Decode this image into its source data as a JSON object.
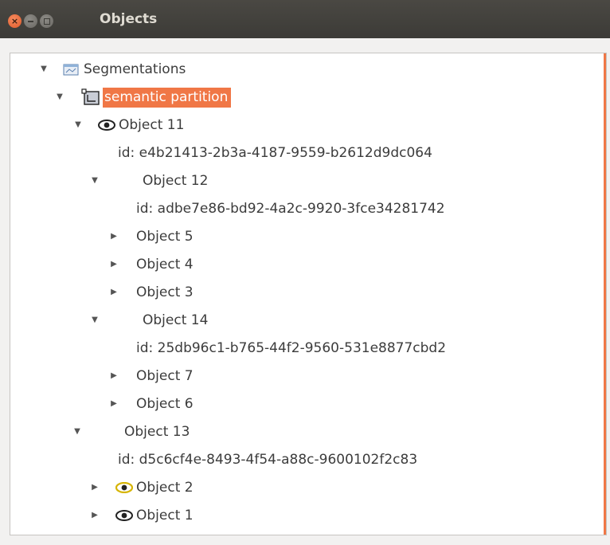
{
  "window": {
    "title": "Objects"
  },
  "tree": {
    "root": {
      "label": "Segmentations"
    },
    "partition": {
      "label": "semantic partition"
    },
    "obj11": {
      "label": "Object 11",
      "id": "id: e4b21413-2b3a-4187-9559-b2612d9dc064"
    },
    "obj12": {
      "label": "Object 12",
      "id": "id: adbe7e86-bd92-4a2c-9920-3fce34281742"
    },
    "obj5": {
      "label": "Object 5"
    },
    "obj4": {
      "label": "Object 4"
    },
    "obj3": {
      "label": "Object 3"
    },
    "obj14": {
      "label": "Object 14",
      "id": "id: 25db96c1-b765-44f2-9560-531e8877cbd2"
    },
    "obj7": {
      "label": "Object 7"
    },
    "obj6": {
      "label": "Object 6"
    },
    "obj13": {
      "label": "Object 13",
      "id": "id: d5c6cf4e-8493-4f54-a88c-9600102f2c83"
    },
    "obj2": {
      "label": "Object 2"
    },
    "obj1": {
      "label": "Object 1"
    }
  },
  "colors": {
    "accent": "#f07746",
    "eye_yellow": "#d6b400",
    "eye_black": "#222222"
  },
  "icons": {
    "segmentations": "folder-icon",
    "partition": "partition-icon",
    "visibility": "eye-icon"
  }
}
